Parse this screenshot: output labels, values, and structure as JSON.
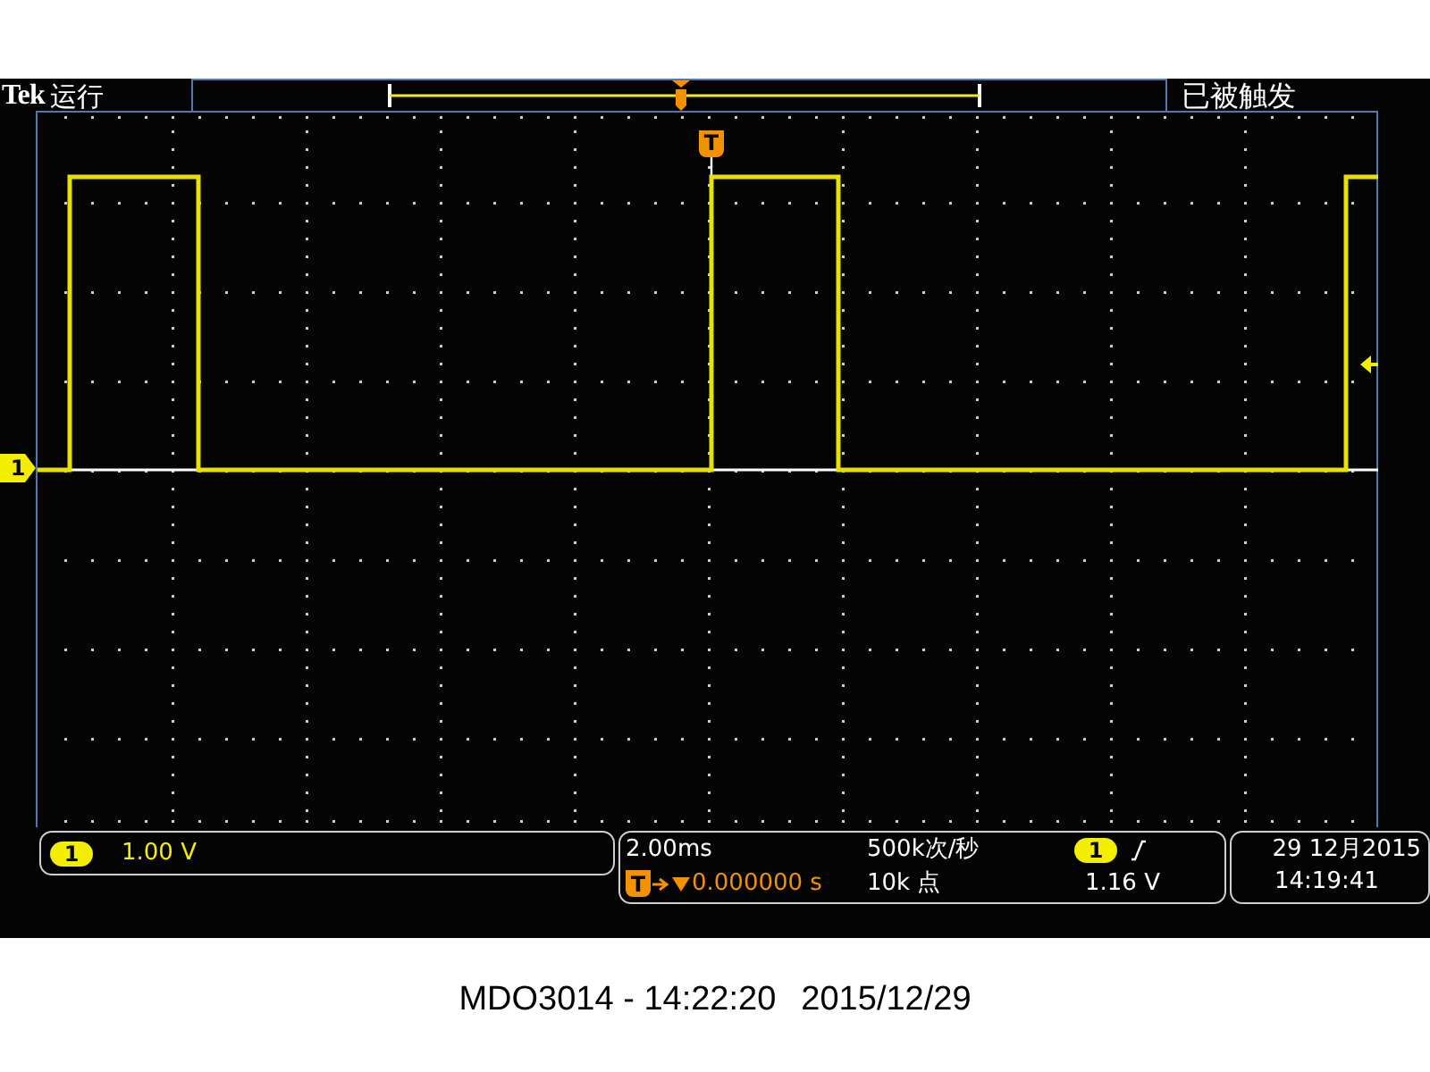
{
  "header": {
    "brand": "Tek",
    "run_state": "运行",
    "trigger_status": "已被触发",
    "trigger_marker": "T"
  },
  "channel_marker": "1",
  "channel_panel": {
    "channel": "1",
    "scale": "1.00 V"
  },
  "timebase_panel": {
    "time_per_div": "2.00ms",
    "trigger_marker": "T",
    "position": "0.000000 s",
    "sample_rate": "500k次/秒",
    "record_length": "10k 点",
    "trigger_channel": "1",
    "trigger_level": "1.16 V"
  },
  "date_panel": {
    "date": "29 12月2015",
    "time": "14:19:41"
  },
  "caption": {
    "model_time": "MDO3014 - 14:22:20",
    "date": "2015/12/29"
  }
}
